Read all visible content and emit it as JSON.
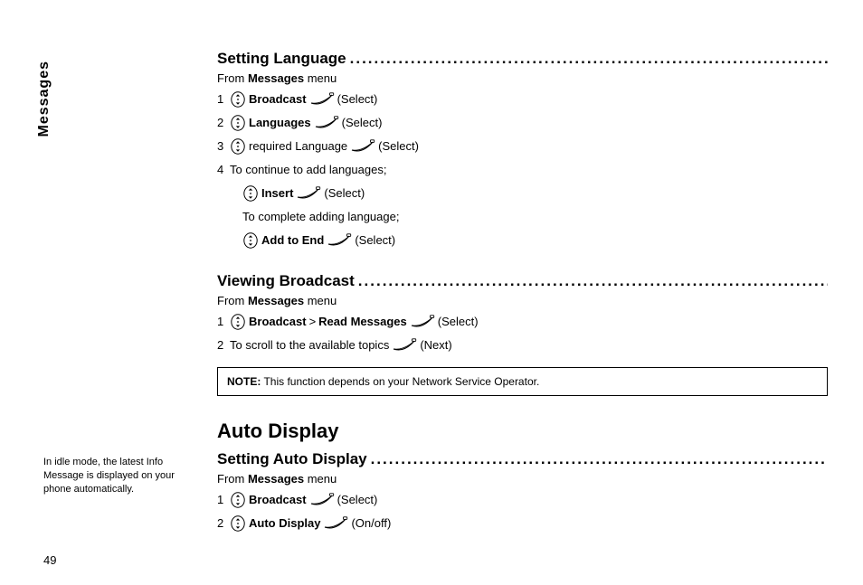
{
  "sideTab": "Messages",
  "pageNumber": "49",
  "marginNote": "In idle mode, the latest Info Message is displayed on your phone automatically.",
  "leader": "....................................................................................................................................................................................................",
  "sections": {
    "settingLanguage": {
      "title": "Setting Language",
      "fromPrefix": "From ",
      "fromBold": "Messages",
      "fromSuffix": " menu",
      "step1": {
        "num": "1",
        "bold": "Broadcast",
        "action": "(Select)"
      },
      "step2": {
        "num": "2",
        "bold": "Languages",
        "action": "(Select)"
      },
      "step3": {
        "num": "3",
        "mid": " required Language ",
        "action": "(Select)"
      },
      "step4": {
        "num": "4",
        "text": "To continue to add languages;"
      },
      "step4a": {
        "bold": "Insert",
        "action": "(Select)"
      },
      "step4b": {
        "text": "To complete adding language;"
      },
      "step4c": {
        "bold": "Add to End",
        "action": "(Select)"
      }
    },
    "viewingBroadcast": {
      "title": "Viewing Broadcast",
      "fromPrefix": "From ",
      "fromBold": "Messages",
      "fromSuffix": " menu",
      "step1": {
        "num": "1",
        "bold1": "Broadcast",
        "sep": " > ",
        "bold2": "Read Messages",
        "action": "(Select)"
      },
      "step2": {
        "num": "2",
        "text": "To scroll to the available topics ",
        "action": "(Next)"
      }
    },
    "note": {
      "label": "NOTE:",
      "text": " This function depends on your Network Service Operator."
    },
    "autoDisplay": {
      "heading": "Auto Display",
      "sub": {
        "title": "Setting Auto Display",
        "fromPrefix": "From ",
        "fromBold": "Messages",
        "fromSuffix": " menu",
        "step1": {
          "num": "1",
          "bold": "Broadcast",
          "action": "(Select)"
        },
        "step2": {
          "num": "2",
          "bold": "Auto Display",
          "action": "(On/off)"
        }
      }
    }
  }
}
